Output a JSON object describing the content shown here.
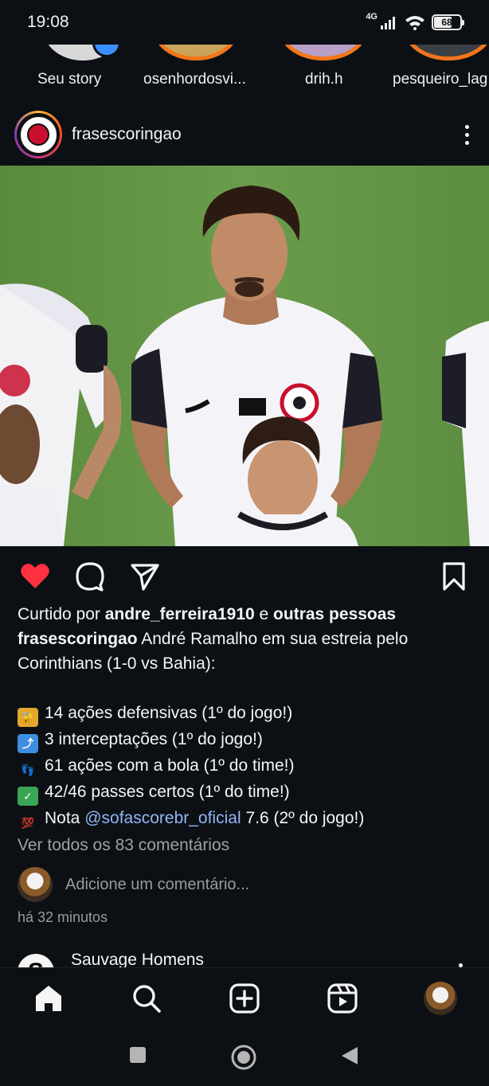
{
  "status_bar": {
    "time": "19:08",
    "network": "4G",
    "battery": "68"
  },
  "stories": [
    {
      "label": "Seu story"
    },
    {
      "label": "osenhordosvi..."
    },
    {
      "label": "drih.h"
    },
    {
      "label": "pesqueiro_lag"
    }
  ],
  "post": {
    "username": "frasescoringao",
    "liked_by_prefix": "Curtido por ",
    "liked_by_user": "andre_ferreira1910",
    "liked_by_and": " e ",
    "liked_by_others": "outras pessoas",
    "caption_user": "frasescoringao",
    "caption_line1": " André Ramalho em sua estreia pelo",
    "caption_line2": "Corinthians (1-0 vs Bahia):",
    "stats": [
      {
        "icon": "lock-key-emoji",
        "text": "14 ações defensivas (1º do jogo!)"
      },
      {
        "icon": "arrow-up-emoji",
        "text": "3 interceptações (1º do jogo!)"
      },
      {
        "icon": "footprints-emoji",
        "text": "61 ações com a bola (1º do time!)"
      },
      {
        "icon": "check-mark-emoji",
        "text": "42/46 passes certos (1º do time!)"
      }
    ],
    "rating_prefix": "Nota ",
    "rating_mention": "@sofascorebr_oficial",
    "rating_suffix": " 7.6 (2º do jogo!)",
    "view_comments": "Ver todos os 83 comentários",
    "add_comment_placeholder": "Adicione um comentário...",
    "time_ago": "há 32 minutos"
  },
  "next_post": {
    "avatar_letter": "S",
    "username": "Sauvage Homens"
  },
  "colors": {
    "background": "#0c1014",
    "like_red": "#ff3040",
    "mention_blue": "#92b6f5"
  }
}
